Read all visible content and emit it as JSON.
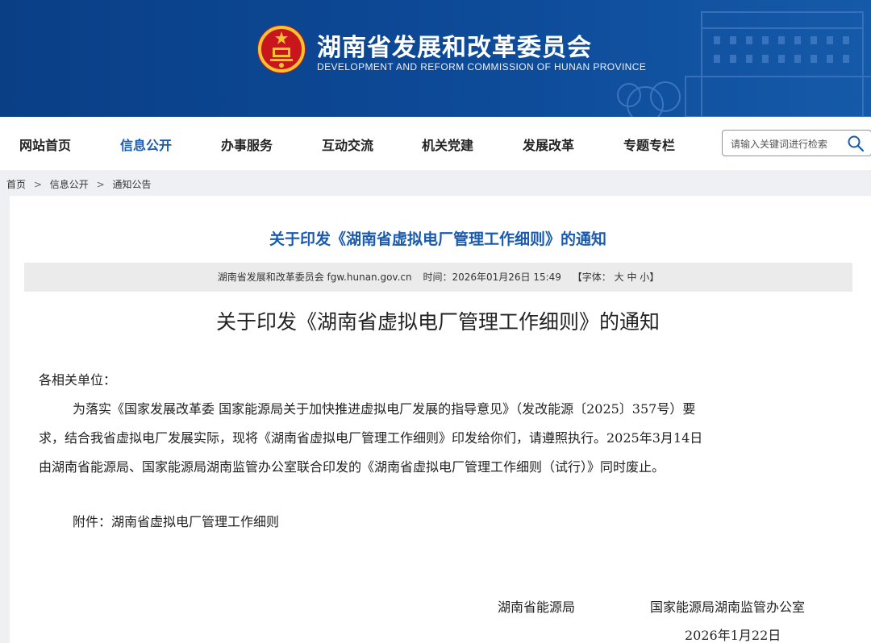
{
  "header": {
    "site_title": "湖南省发展和改革委员会",
    "site_subtitle": "DEVELOPMENT AND REFORM COMMISSION OF HUNAN PROVINCE",
    "brand_color": "#0d4a98"
  },
  "nav": {
    "items": [
      {
        "label": "网站首页",
        "active": false
      },
      {
        "label": "信息公开",
        "active": true
      },
      {
        "label": "办事服务",
        "active": false
      },
      {
        "label": "互动交流",
        "active": false
      },
      {
        "label": "机关党建",
        "active": false
      },
      {
        "label": "发展改革",
        "active": false
      },
      {
        "label": "专题专栏",
        "active": false
      }
    ],
    "search_placeholder": "请输入关键词进行检索"
  },
  "breadcrumb": [
    "首页",
    "信息公开",
    "通知公告"
  ],
  "article": {
    "title": "关于印发《湖南省虚拟电厂管理工作细则》的通知",
    "meta": {
      "source": "湖南省发展和改革委员会 fgw.hunan.gov.cn",
      "time": "时间：2026年01月26日 15:49",
      "font_label": "【字体：",
      "font_large": "大",
      "font_medium": "中",
      "font_small": "小",
      "font_close": "】"
    },
    "body_title": "关于印发《湖南省虚拟电厂管理工作细则》的通知",
    "salutation": "各相关单位：",
    "paragraph_lines": [
      "为落实《国家发展改革委 国家能源局关于加快推进虚拟电厂发展的指导意见》（发改能源〔2025〕357号）要",
      "求，结合我省虚拟电厂发展实际，现将《湖南省虚拟电厂管理工作细则》印发给你们，请遵照执行。2025年3月14日",
      "由湖南省能源局、国家能源局湖南监管办公室联合印发的《湖南省虚拟电厂管理工作细则（试行）》同时废止。"
    ],
    "attachment": "附件：湖南省虚拟电厂管理工作细则",
    "signer_1": "湖南省能源局",
    "signer_2": "国家能源局湖南监管办公室",
    "date": "2026年1月22日"
  }
}
